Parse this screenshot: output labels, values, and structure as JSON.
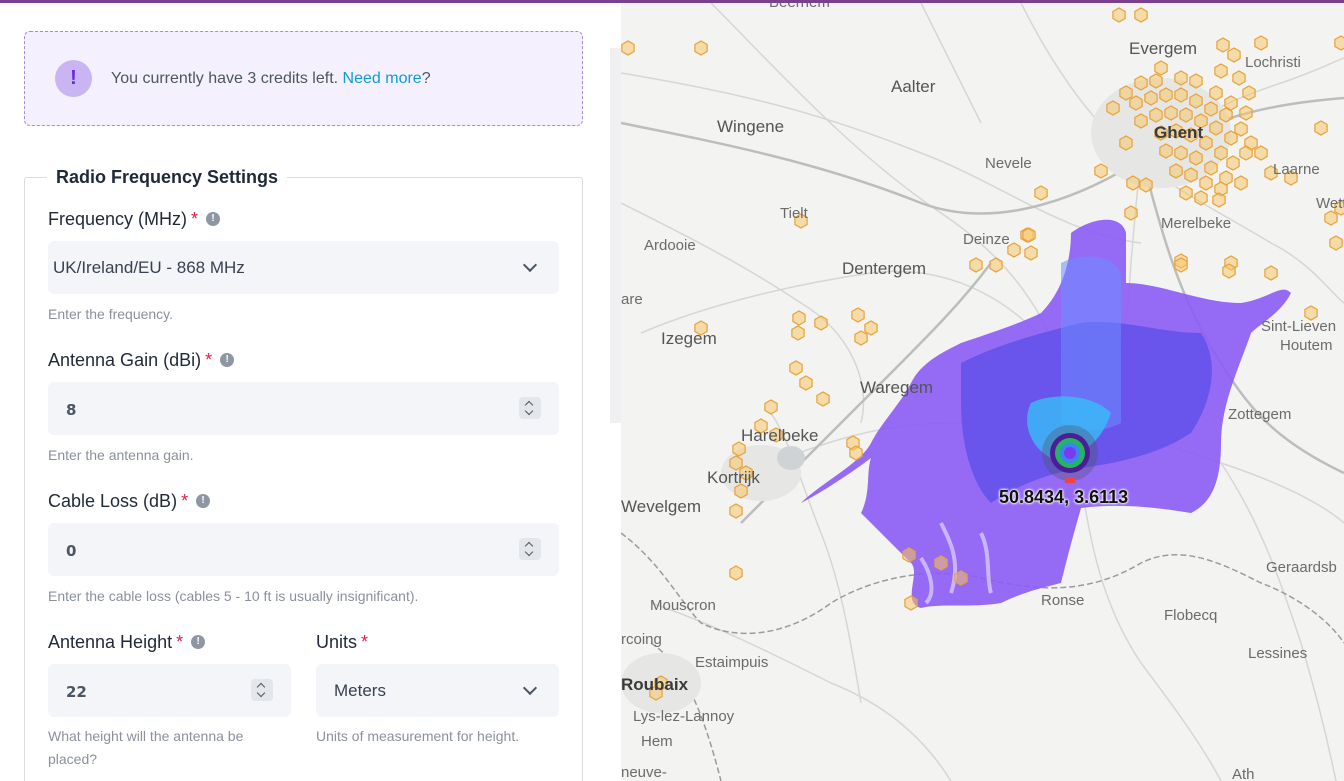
{
  "credits": {
    "message": "You currently have 3 credits left.",
    "link": "Need more",
    "suffix": "?"
  },
  "form": {
    "legend": "Radio Frequency Settings",
    "frequency": {
      "label": "Frequency (MHz)",
      "value": "UK/Ireland/EU - 868 MHz",
      "help": "Enter the frequency."
    },
    "gain": {
      "label": "Antenna Gain (dBi)",
      "value": "8",
      "help": "Enter the antenna gain."
    },
    "cable_loss": {
      "label": "Cable Loss (dB)",
      "value": "0",
      "help": "Enter the cable loss (cables 5 - 10 ft is usually insignificant)."
    },
    "height": {
      "label": "Antenna Height",
      "value": "22",
      "help": "What height will the antenna be placed?"
    },
    "units": {
      "label": "Units",
      "value": "Meters",
      "help": "Units of measurement for height."
    },
    "required_mark": "*",
    "info_glyph": "!"
  },
  "map": {
    "coordinate": "50.8434, 3.6113",
    "places": [
      "Beernem",
      "Evergem",
      "Lochristi",
      "Aalter",
      "Wingene",
      "Ghent",
      "Nevele",
      "Laarne",
      "Wette",
      "Tielt",
      "Merelbeke",
      "Ardooie",
      "Deinze",
      "Dentergem",
      "are",
      "Izegem",
      "Sint-Lieven",
      "Houtem",
      "Waregem",
      "Zottegem",
      "Harelbeke",
      "Kortrijk",
      "Wevelgem",
      "Geraardsb",
      "Mouscron",
      "Ronse",
      "Flobecq",
      "rcoing",
      "Estaimpuis",
      "Lessines",
      "Roubaix",
      "Lys-lez-Lannoy",
      "Hem",
      "neuve-",
      "Ath"
    ]
  },
  "colors": {
    "accent": "#0f9bd7",
    "required": "#e11d48",
    "coverage": "#8b5cf6",
    "gateway": "#f5c76a"
  }
}
